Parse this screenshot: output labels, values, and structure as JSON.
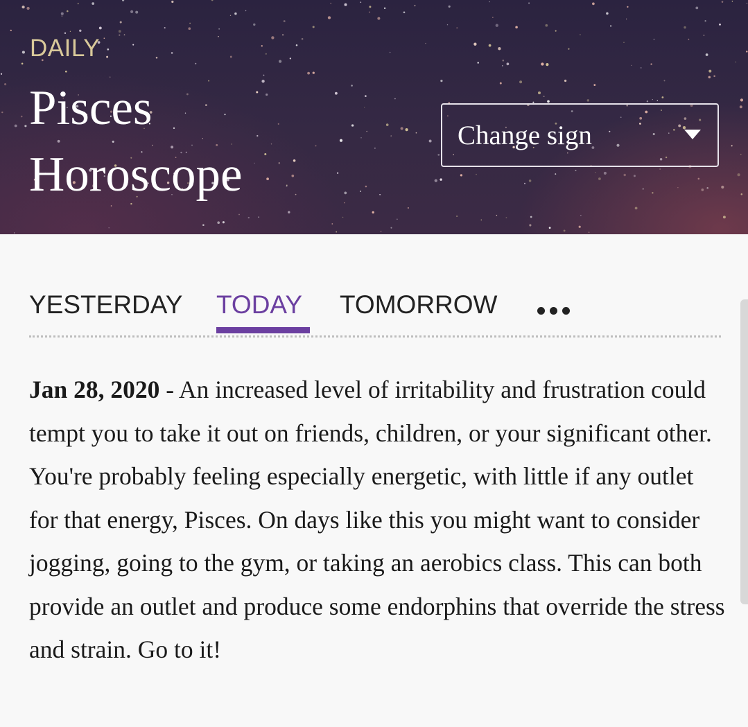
{
  "header": {
    "eyebrow": "DAILY",
    "title_line1": "Pisces",
    "title_line2": "Horoscope",
    "change_sign_label": "Change sign"
  },
  "tabs": [
    {
      "label": "YESTERDAY",
      "active": false
    },
    {
      "label": "TODAY",
      "active": true
    },
    {
      "label": "TOMORROW",
      "active": false
    },
    {
      "label": "more-options",
      "icon": "more-horizontal-icon"
    }
  ],
  "reading": {
    "date": "Jan 28, 2020",
    "separator": " - ",
    "text": "An increased level of irritability and frustration could tempt you to take it out on friends, children, or your significant other. You're probably feeling especially energetic, with little if any outlet for that energy, Pisces. On days like this you might want to consider jogging, going to the gym, or taking an aerobics class. This can both provide an outlet and produce some endorphins that override the stress and strain. Go to it!"
  },
  "colors": {
    "accent": "#6b3fa0",
    "eyebrow": "#d9c99a",
    "hero_bg": "#2b2340"
  }
}
